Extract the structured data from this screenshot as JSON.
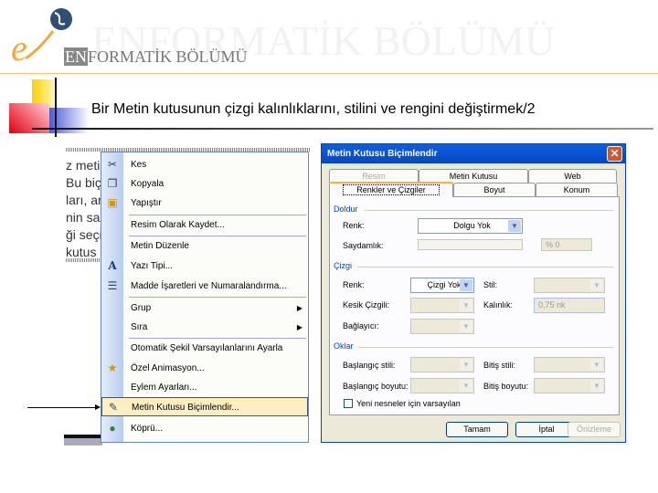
{
  "header": {
    "watermark": "ENFORMATİK BÖLÜMÜ",
    "brand_en": "EN",
    "brand_rest": "FORMATİK BÖLÜMÜ",
    "slide_title": "Bir Metin kutusunun çizgi kalınlıklarını, stilini ve rengini değiştirmek/2"
  },
  "background_text": [
    "z metin",
    "Bu biç",
    "ları, ar",
    "nin sağ",
    "ği seçil",
    "kutus"
  ],
  "menu": {
    "items": [
      {
        "label": "Kes",
        "icon": "scissors-icon"
      },
      {
        "label": "Kopyala",
        "icon": "copy-icon"
      },
      {
        "label": "Yapıştır",
        "icon": "paste-icon"
      },
      {
        "label": "Resim Olarak Kaydet..."
      },
      {
        "label": "Metin Düzenle"
      },
      {
        "label": "Yazı Tipi...",
        "icon": "font-icon"
      },
      {
        "label": "Madde İşaretleri ve Numaralandırma...",
        "icon": "bullets-icon"
      },
      {
        "label": "Grup",
        "submenu": true
      },
      {
        "label": "Sıra",
        "submenu": true
      },
      {
        "label": "Otomatik Şekil Varsayılanlarını Ayarla"
      },
      {
        "label": "Özel Animasyon...",
        "icon": "animation-icon"
      },
      {
        "label": "Eylem Ayarları..."
      },
      {
        "label": "Metin Kutusu Biçimlendir...",
        "icon": "format-textbox-icon",
        "highlighted": true
      },
      {
        "label": "Köprü...",
        "icon": "hyperlink-icon"
      }
    ]
  },
  "dialog": {
    "title": "Metin Kutusu Biçimlendir",
    "tabs_back": [
      "Resim",
      "Metin Kutusu",
      "Web"
    ],
    "tabs_front": [
      "Renkler ve Çizgiler",
      "Boyut",
      "Konum"
    ],
    "active_tab": "Renkler ve Çizgiler",
    "fill": {
      "group": "Doldur",
      "color_label": "Renk:",
      "color_value": "Dolgu Yok",
      "transparency_label": "Saydamlık:",
      "transparency_value": "% 0"
    },
    "line": {
      "group": "Çizgi",
      "color_label": "Renk:",
      "color_value": "Çizgi Yok",
      "style_label": "Stil:",
      "dash_label": "Kesik Çizgili:",
      "weight_label": "Kalınlık:",
      "weight_value": "0,75 nk",
      "connector_label": "Bağlayıcı:"
    },
    "arrows": {
      "group": "Oklar",
      "begin_style": "Başlangıç stili:",
      "end_style": "Bitiş stili:",
      "begin_size": "Başlangıç boyutu:",
      "end_size": "Bitiş boyutu:"
    },
    "default_checkbox": "Yeni nesneler için varsayılan",
    "default_checked": false,
    "ok": "Tamam",
    "cancel": "İptal",
    "preview": "Önizleme"
  },
  "colors": {
    "titlebar": "#0a5fe0",
    "menu_highlight": "#ffeec2",
    "group_label": "#0046d5",
    "accent_orange": "#f5b041"
  }
}
